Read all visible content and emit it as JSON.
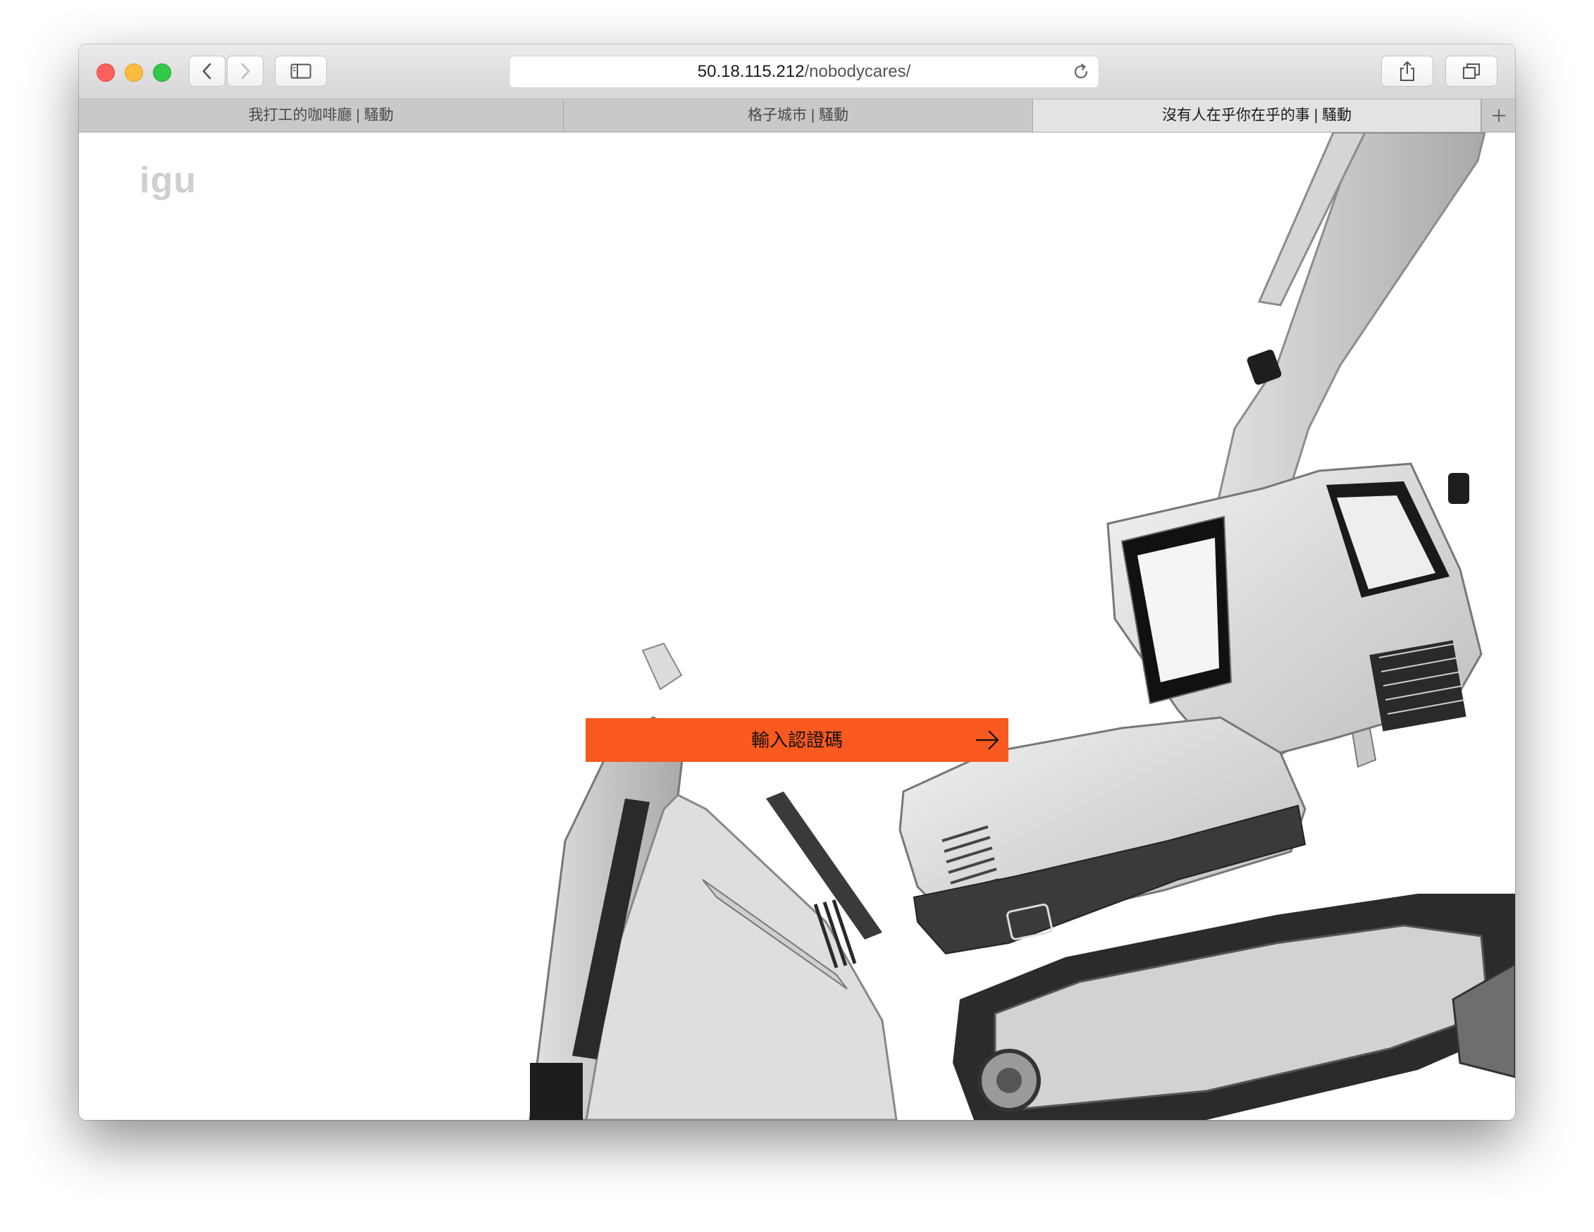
{
  "browser": {
    "address": {
      "host": "50.18.115.212",
      "path": "/nobodycares/"
    },
    "tabs": [
      {
        "label": "我打工的咖啡廳 | 騷動",
        "active": false
      },
      {
        "label": "格子城市 | 騷動",
        "active": false
      },
      {
        "label": "沒有人在乎你在乎的事 | 騷動",
        "active": true
      }
    ]
  },
  "page": {
    "logo": "igu",
    "cta_label": "輸入認證碼",
    "accent_color": "#fa591f",
    "hero_image": "excavator-image"
  }
}
